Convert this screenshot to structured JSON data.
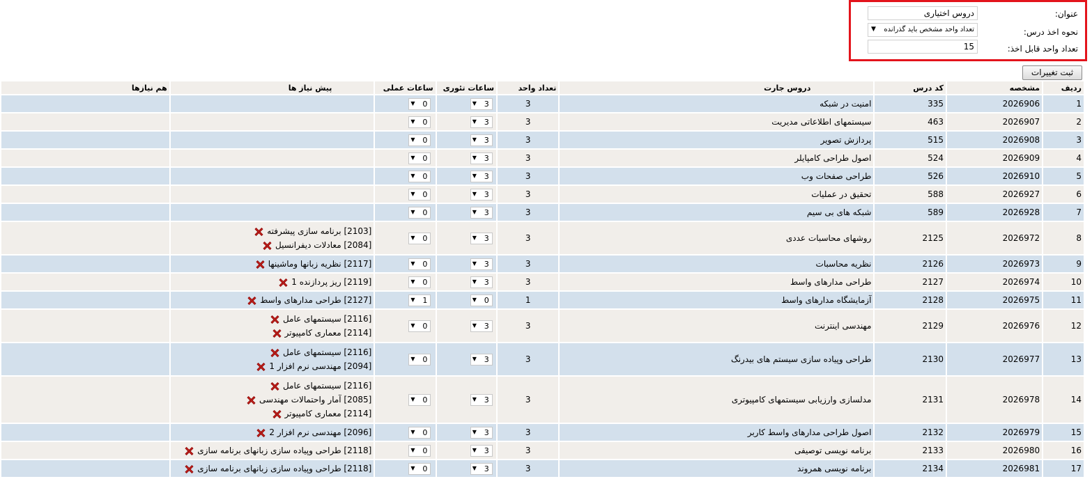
{
  "form": {
    "title_label": "عنوان:",
    "title_value": "دروس اختیاری",
    "method_label": "نحوه اخذ درس:",
    "method_value": "تعداد واحد مشخص باید گذرانده",
    "units_label": "تعداد واحد قابل اخذ:",
    "units_value": "15"
  },
  "save_button": "ثبت تغییرات",
  "columns": {
    "row": "ردیف",
    "id": "مشخصه",
    "code": "کد درس",
    "course": "دروس جارت",
    "units": "تعداد واحد",
    "theory": "ساعات تئوری",
    "practical": "ساعات عملی",
    "prereq": "پیش نیاز ها",
    "coreq": "هم نیازها"
  },
  "rows": [
    {
      "row": "1",
      "id": "2026906",
      "code": "335",
      "course": "امنیت در شبکه",
      "units": "3",
      "theory": "3",
      "practical": "0",
      "prereqs": []
    },
    {
      "row": "2",
      "id": "2026907",
      "code": "463",
      "course": "سیستمهای اطلاعاتی مدیریت",
      "units": "3",
      "theory": "3",
      "practical": "0",
      "prereqs": []
    },
    {
      "row": "3",
      "id": "2026908",
      "code": "515",
      "course": "پردازش تصویر",
      "units": "3",
      "theory": "3",
      "practical": "0",
      "prereqs": []
    },
    {
      "row": "4",
      "id": "2026909",
      "code": "524",
      "course": "اصول طراحی کامپایلر",
      "units": "3",
      "theory": "3",
      "practical": "0",
      "prereqs": []
    },
    {
      "row": "5",
      "id": "2026910",
      "code": "526",
      "course": "طراحی صفحات وب",
      "units": "3",
      "theory": "3",
      "practical": "0",
      "prereqs": []
    },
    {
      "row": "6",
      "id": "2026927",
      "code": "588",
      "course": "تحقیق در عملیات",
      "units": "3",
      "theory": "3",
      "practical": "0",
      "prereqs": []
    },
    {
      "row": "7",
      "id": "2026928",
      "code": "589",
      "course": "شبکه های بی سیم",
      "units": "3",
      "theory": "3",
      "practical": "0",
      "prereqs": []
    },
    {
      "row": "8",
      "id": "2026972",
      "code": "2125",
      "course": "روشهای محاسبات عددی",
      "units": "3",
      "theory": "3",
      "practical": "0",
      "prereqs": [
        "[2103] برنامه سازی پیشرفته",
        "[2084] معادلات دیفرانسیل"
      ]
    },
    {
      "row": "9",
      "id": "2026973",
      "code": "2126",
      "course": "نظریه محاسبات",
      "units": "3",
      "theory": "3",
      "practical": "0",
      "prereqs": [
        "[2117] نظریه زبانها وماشینها"
      ]
    },
    {
      "row": "10",
      "id": "2026974",
      "code": "2127",
      "course": "طراحی مدارهای واسط",
      "units": "3",
      "theory": "3",
      "practical": "0",
      "prereqs": [
        "[2119] ریز پردازنده 1"
      ]
    },
    {
      "row": "11",
      "id": "2026975",
      "code": "2128",
      "course": "آزمایشگاه مدارهای واسط",
      "units": "1",
      "theory": "0",
      "practical": "1",
      "prereqs": [
        "[2127] طراحی مدارهای واسط"
      ]
    },
    {
      "row": "12",
      "id": "2026976",
      "code": "2129",
      "course": "مهندسی اینترنت",
      "units": "3",
      "theory": "3",
      "practical": "0",
      "prereqs": [
        "[2116] سیستمهای عامل",
        "[2114] معماری کامپیوتر"
      ]
    },
    {
      "row": "13",
      "id": "2026977",
      "code": "2130",
      "course": "طراحی وپیاده سازی سیستم های بیدرنگ",
      "units": "3",
      "theory": "3",
      "practical": "0",
      "prereqs": [
        "[2116] سیستمهای عامل",
        "[2094] مهندسی نرم افزار 1"
      ]
    },
    {
      "row": "14",
      "id": "2026978",
      "code": "2131",
      "course": "مدلسازی وارزیابی سیستمهای کامپیوتری",
      "units": "3",
      "theory": "3",
      "practical": "0",
      "prereqs": [
        "[2116] سیستمهای عامل",
        "[2085] آمار واحتمالات مهندسی",
        "[2114] معماری کامپیوتر"
      ]
    },
    {
      "row": "15",
      "id": "2026979",
      "code": "2132",
      "course": "اصول طراحی مدارهای واسط کاربر",
      "units": "3",
      "theory": "3",
      "practical": "0",
      "prereqs": [
        "[2096] مهندسی نرم افزار 2"
      ]
    },
    {
      "row": "16",
      "id": "2026980",
      "code": "2133",
      "course": "برنامه نویسی توصیفی",
      "units": "3",
      "theory": "3",
      "practical": "0",
      "prereqs": [
        "[2118] طراحی وپیاده سازی زبانهای برنامه سازی"
      ]
    },
    {
      "row": "17",
      "id": "2026981",
      "code": "2134",
      "course": "برنامه نویسی همروند",
      "units": "3",
      "theory": "3",
      "practical": "0",
      "prereqs": [
        "[2118] طراحی وپیاده سازی زبانهای برنامه سازی"
      ]
    }
  ]
}
